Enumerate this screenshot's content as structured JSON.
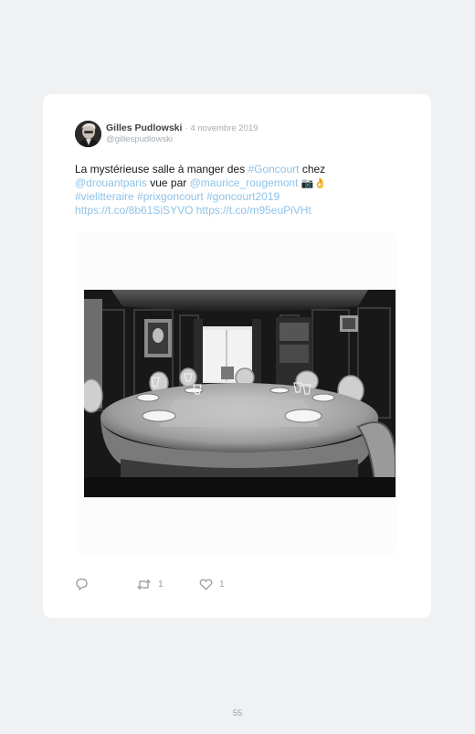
{
  "tweet": {
    "author": {
      "display_name": "Gilles Pudlowski",
      "handle": "@gillespudlowski"
    },
    "separator": "·",
    "date": "4 novembre 2019",
    "text": {
      "t1": "La mystérieuse salle à manger des ",
      "hashtag_goncourt": "#Goncourt",
      "t2": " chez",
      "mention_drouant": "@drouantparis",
      "t3": " vue par ",
      "mention_rougemont": "@maurice_rougemont",
      "emojis": "📷👌",
      "hashtag_vielitteraire": "#vielitteraire",
      "hashtag_prixgoncourt": "#prixgoncourt",
      "hashtag_goncourt2019": "#goncourt2019",
      "link1": "https://t.co/8b61SiSYVO",
      "link2": "https://t.co/m95euPiVHt"
    },
    "actions": {
      "reply_icon": "reply-icon",
      "retweet_icon": "retweet-icon",
      "retweet_count": "1",
      "like_icon": "heart-icon",
      "like_count": "1"
    },
    "colors": {
      "link": "#8fc3e8",
      "muted": "#a5acb4"
    }
  },
  "page": {
    "number": "55"
  }
}
